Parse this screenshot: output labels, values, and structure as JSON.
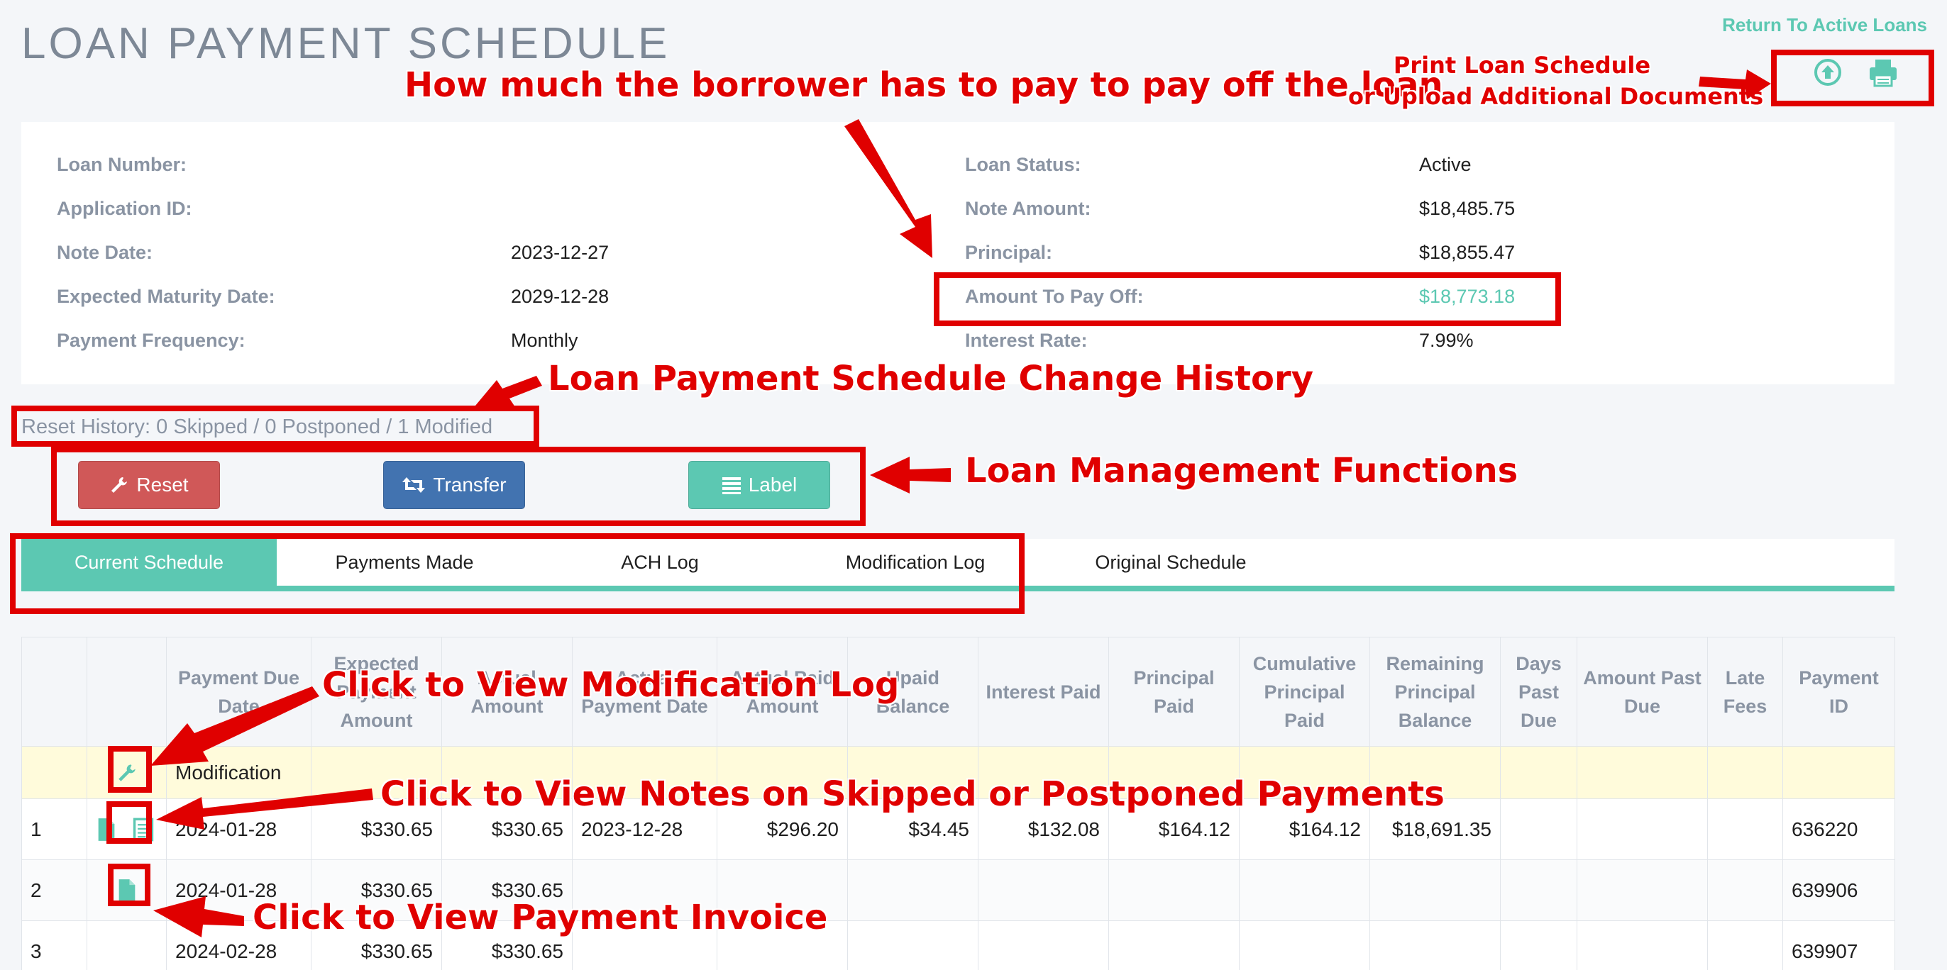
{
  "title": "LOAN PAYMENT SCHEDULE",
  "return_link": "Return To Active Loans",
  "icons": {
    "upload": "upload-circle-icon",
    "print": "printer-icon"
  },
  "info_left": [
    {
      "label": "Loan Number:",
      "value": ""
    },
    {
      "label": "Application ID:",
      "value": ""
    },
    {
      "label": "Note Date:",
      "value": "2023-12-27"
    },
    {
      "label": "Expected Maturity Date:",
      "value": "2029-12-28"
    },
    {
      "label": "Payment Frequency:",
      "value": "Monthly"
    }
  ],
  "info_right": [
    {
      "label": "Loan Status:",
      "value": "Active"
    },
    {
      "label": "Note Amount:",
      "value": "$18,485.75"
    },
    {
      "label": "Principal:",
      "value": "$18,855.47"
    },
    {
      "label": "Amount To Pay Off:",
      "value": "$18,773.18"
    },
    {
      "label": "Interest Rate:",
      "value": "7.99%"
    }
  ],
  "reset_history": "Reset History: 0 Skipped / 0 Postponed / 1 Modified",
  "buttons": {
    "reset": "Reset",
    "transfer": "Transfer",
    "label": "Label"
  },
  "tabs": [
    "Current Schedule",
    "Payments Made",
    "ACH Log",
    "Modification Log",
    "Original Schedule"
  ],
  "table": {
    "headers": [
      "",
      "",
      "Payment Due Date",
      "Expected Payment Amount",
      "Actual Amount",
      "Actual Payment Date",
      "Actual Paid Amount",
      "Upaid Balance",
      "Interest Paid",
      "Principal Paid",
      "Cumulative Principal Paid",
      "Remaining Principal Balance",
      "Days Past Due",
      "Amount Past Due",
      "Late Fees",
      "Payment ID"
    ],
    "modification_label": "Modification",
    "rows": [
      {
        "num": "1",
        "due": "2024-01-28",
        "expected": "$330.65",
        "amount": "$330.65",
        "actual_date": "2023-12-28",
        "actual_amount": "$296.20",
        "unpaid": "$34.45",
        "interest": "$132.08",
        "principal": "$164.12",
        "cumulative": "$164.12",
        "remaining": "$18,691.35",
        "days_past": "",
        "amount_past": "",
        "late_fees": "",
        "payment_id": "636220"
      },
      {
        "num": "2",
        "due": "2024-01-28",
        "expected": "$330.65",
        "amount": "$330.65",
        "actual_date": "",
        "actual_amount": "",
        "unpaid": "",
        "interest": "",
        "principal": "",
        "cumulative": "",
        "remaining": "",
        "days_past": "",
        "amount_past": "",
        "late_fees": "",
        "payment_id": "639906"
      },
      {
        "num": "3",
        "due": "2024-02-28",
        "expected": "$330.65",
        "amount": "$330.65",
        "actual_date": "",
        "actual_amount": "",
        "unpaid": "",
        "interest": "",
        "principal": "",
        "cumulative": "",
        "remaining": "",
        "days_past": "",
        "amount_past": "",
        "late_fees": "",
        "payment_id": "639907"
      }
    ]
  },
  "annotations": {
    "payoff": "How much the borrower has to pay to pay off the loan",
    "print_upload_line1": "Print Loan Schedule",
    "print_upload_line2": "or Upload Additional Documents",
    "history": "Loan Payment Schedule Change History",
    "management": "Loan Management Functions",
    "mod_log": "Click to View Modification Log",
    "notes": "Click to View Notes on Skipped or Postponed Payments",
    "invoice": "Click to View Payment Invoice"
  },
  "colors": {
    "teal": "#5cc8b2",
    "reset": "#d05858",
    "transfer": "#4273b0",
    "annotation": "#e00000"
  }
}
